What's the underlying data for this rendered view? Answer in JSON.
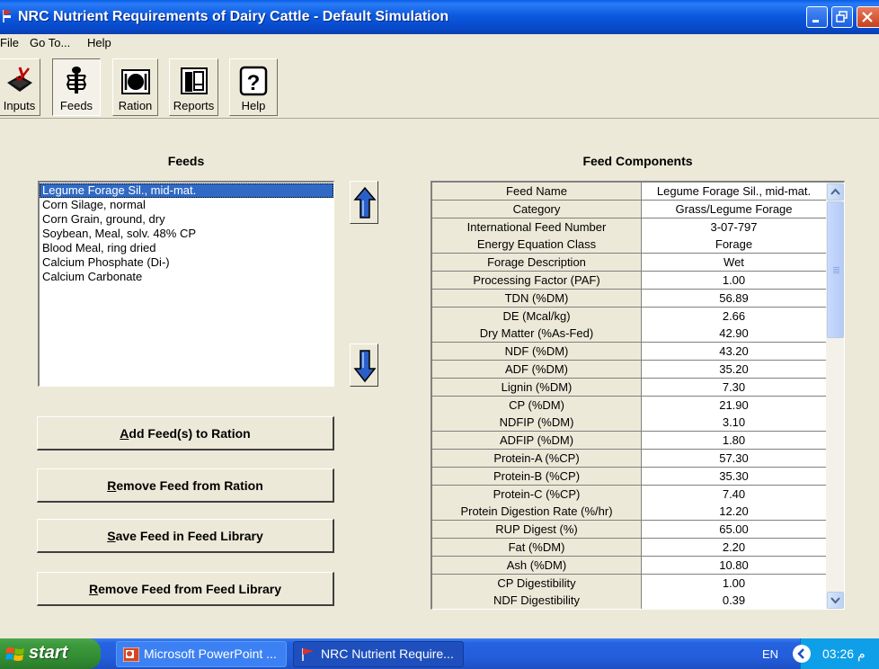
{
  "window": {
    "title": "NRC Nutrient Requirements of Dairy Cattle - Default Simulation"
  },
  "menu": {
    "items": [
      "File",
      "Go To...",
      "Help"
    ]
  },
  "toolbar": {
    "buttons": [
      {
        "label": "Inputs",
        "icon": "inputs-icon"
      },
      {
        "label": "Feeds",
        "icon": "feeds-icon",
        "active": true
      },
      {
        "label": "Ration",
        "icon": "ration-icon"
      },
      {
        "label": "Reports",
        "icon": "reports-icon"
      },
      {
        "label": "Help",
        "icon": "help-icon"
      }
    ]
  },
  "feeds": {
    "heading": "Feeds",
    "items": [
      "Legume Forage Sil., mid-mat.",
      "Corn Silage, normal",
      "Corn Grain, ground, dry",
      "Soybean, Meal, solv. 48% CP",
      "Blood Meal, ring dried",
      "Calcium Phosphate (Di-)",
      "Calcium Carbonate"
    ],
    "selected_index": 0
  },
  "actions": {
    "add_to_ration": {
      "accel": "A",
      "rest": "dd Feed(s) to Ration"
    },
    "remove_from_ration": {
      "accel": "R",
      "rest": "emove Feed from Ration"
    },
    "save_in_library": {
      "accel": "S",
      "rest": "ave Feed in Feed Library"
    },
    "remove_from_library": {
      "accel": "R",
      "rest": "emove Feed from Feed Library"
    }
  },
  "components": {
    "heading": "Feed Components",
    "rows": [
      {
        "label": "Feed Name",
        "value": "Legume Forage Sil., mid-mat."
      },
      {
        "label": "Category",
        "value": "Grass/Legume Forage"
      },
      {
        "label": "International Feed Number",
        "value": "3-07-797"
      },
      {
        "label": "Energy Equation Class",
        "value": "Forage"
      },
      {
        "label": "Forage Description",
        "value": "Wet"
      },
      {
        "label": "Processing Factor (PAF)",
        "value": "1.00"
      },
      {
        "label": "TDN (%DM)",
        "value": "56.89"
      },
      {
        "label": "DE (Mcal/kg)",
        "value": "2.66"
      },
      {
        "label": "Dry Matter (%As-Fed)",
        "value": "42.90"
      },
      {
        "label": "NDF (%DM)",
        "value": "43.20"
      },
      {
        "label": "ADF (%DM)",
        "value": "35.20"
      },
      {
        "label": "Lignin (%DM)",
        "value": "7.30"
      },
      {
        "label": "CP (%DM)",
        "value": "21.90"
      },
      {
        "label": "NDFIP (%DM)",
        "value": "3.10"
      },
      {
        "label": "ADFIP (%DM)",
        "value": "1.80"
      },
      {
        "label": "Protein-A (%CP)",
        "value": "57.30"
      },
      {
        "label": "Protein-B (%CP)",
        "value": "35.30"
      },
      {
        "label": "Protein-C (%CP)",
        "value": "7.40"
      },
      {
        "label": "Protein Digestion Rate (%/hr)",
        "value": "12.20"
      },
      {
        "label": "RUP Digest (%)",
        "value": "65.00"
      },
      {
        "label": "Fat (%DM)",
        "value": "2.20"
      },
      {
        "label": "Ash (%DM)",
        "value": "10.80"
      },
      {
        "label": "CP Digestibility",
        "value": "1.00"
      },
      {
        "label": "NDF Digestibility",
        "value": "0.39"
      }
    ]
  },
  "taskbar": {
    "start_label": "start",
    "tasks": [
      {
        "label": "Microsoft PowerPoint ...",
        "icon": "powerpoint-icon"
      },
      {
        "label": "NRC Nutrient Require...",
        "icon": "nrc-app-icon"
      }
    ],
    "language": "EN",
    "clock": "03:26 م"
  },
  "colors": {
    "titlebar_blue": "#0b5ae0",
    "selection_blue": "#316ac5",
    "window_face": "#ece9d8",
    "start_green": "#3c9a3c",
    "taskbar_blue": "#245edb"
  }
}
